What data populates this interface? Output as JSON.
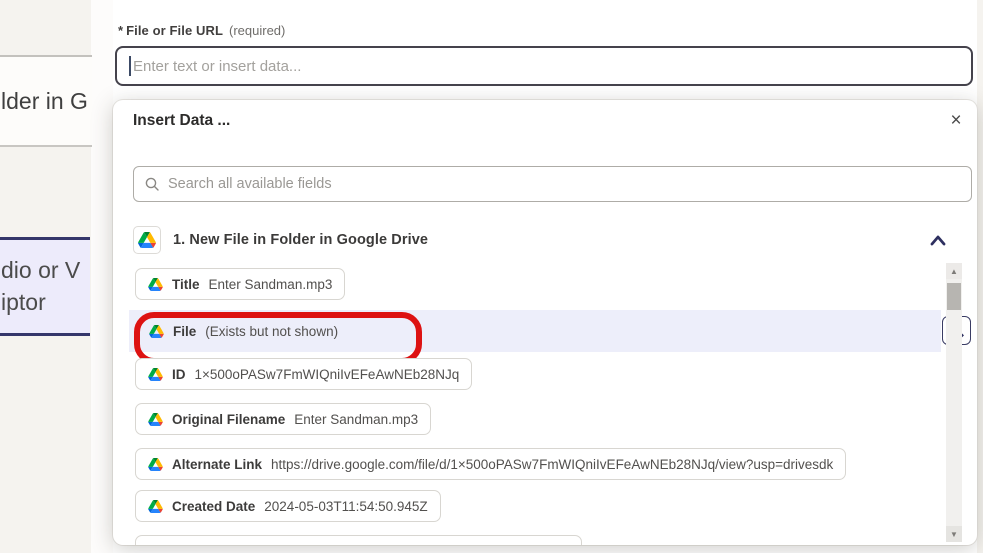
{
  "background": {
    "partial_card_1_text": "lder in G",
    "partial_card_2_line1": "dio or V",
    "partial_card_2_line2": "iptor"
  },
  "field": {
    "asterisk": "*",
    "label": "File or File URL",
    "required_note": "(required)",
    "placeholder": "Enter text or insert data..."
  },
  "panel": {
    "title": "Insert Data ...",
    "close_icon": "×",
    "search_placeholder": "Search all available fields",
    "section_title": "1. New File in Folder in Google Drive",
    "fields": [
      {
        "label": "Title",
        "value": "Enter Sandman.mp3"
      },
      {
        "label": "File",
        "value": "(Exists but not shown)"
      },
      {
        "label": "ID",
        "value": "1×500oPASw7FmWIQniIvEFeAwNEb28NJq"
      },
      {
        "label": "Original Filename",
        "value": "Enter Sandman.mp3"
      },
      {
        "label": "Alternate Link",
        "value": "https://drive.google.com/file/d/1×500oPASw7FmWIQniIvEFeAwNEb28NJq/view?usp=drivesdk"
      },
      {
        "label": "Created Date",
        "value": "2024-05-03T11:54:50.945Z"
      }
    ],
    "scrollbar": {
      "up_icon": "▲",
      "down_icon": "▼"
    }
  },
  "annotation": {
    "type": "red-circle",
    "target_field": "File"
  },
  "colors": {
    "accent_navy": "#34366a",
    "highlight_row": "#edeefa",
    "annotation_red": "#dd1212",
    "drive_blue": "#2684fc",
    "drive_green": "#00ac47",
    "drive_yellow": "#ffba00",
    "drive_red": "#ea4335"
  }
}
